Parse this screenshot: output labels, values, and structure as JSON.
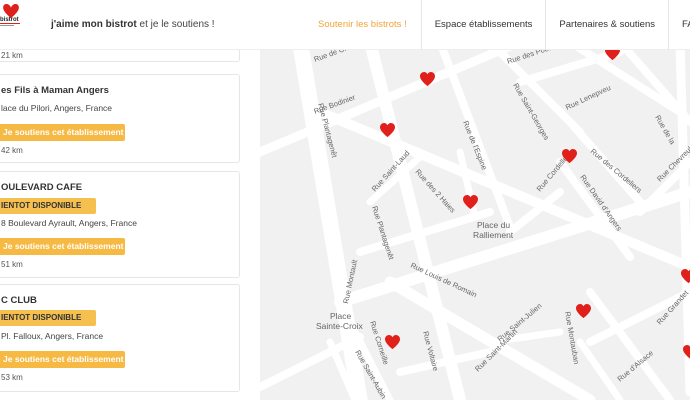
{
  "header": {
    "logo_text": "bistrot",
    "tagline_bold": "j'aime mon bistrot",
    "tagline_rest": " et je le soutiens !",
    "nav": [
      "Soutenir les bistrots !",
      "Espace établissements",
      "Partenaires & soutiens",
      "FA"
    ]
  },
  "list": {
    "cards": [
      {
        "distance": "21 km"
      },
      {
        "title": "es Fils à Maman Angers",
        "address": "lace du Pilori, Angers, France",
        "button": "Je soutiens cet établissement",
        "distance": "42 km"
      },
      {
        "title": "OULEVARD CAFE",
        "badge": "IENTOT DISPONIBLE",
        "address": "8 Boulevard Ayrault, Angers, France",
        "button": "Je soutiens cet établissement",
        "distance": "51 km"
      },
      {
        "title": "C CLUB",
        "badge": "IENTOT DISPONIBLE",
        "address": " Pl. Falloux, Angers, France",
        "button": "Je soutiens cet établissement",
        "distance": "53 km"
      }
    ]
  },
  "map": {
    "streets": [
      "Rue de Crim",
      "Rue des Poeliers",
      "Rue Lenepveu",
      "Rue Bodinier",
      "Rue Saint-Georges",
      "Rue de l'Espine",
      "Rue Plantagenêt",
      "Rue Saint-Laud",
      "Rue des 2 Haies",
      "Rue Cordelle",
      "Rue des Cordeliers",
      "Rue David d'Angers",
      "Rue Chevreul",
      "Rue Plantagenêt",
      "Rue Louis de Romain",
      "Rue Montault",
      "Rue Saint-Julien",
      "Rue Voltaire",
      "Rue Corneille",
      "Rue Saint-Aubin",
      "Rue Saint-Martin",
      "Rue Montauban",
      "Rue d'Alsace",
      "Rue Grandet",
      "Rue de la"
    ],
    "places": [
      {
        "line1": "Place du",
        "line2": "Ralliement"
      },
      {
        "line1": "Place",
        "line2": "Sainte-Croix"
      }
    ],
    "markers": [
      "heart-marker",
      "heart-marker",
      "heart-marker",
      "heart-marker",
      "heart-marker",
      "heart-marker",
      "heart-marker",
      "heart-marker",
      "heart-marker",
      "heart-marker"
    ],
    "marker_color": "#e0201b"
  }
}
